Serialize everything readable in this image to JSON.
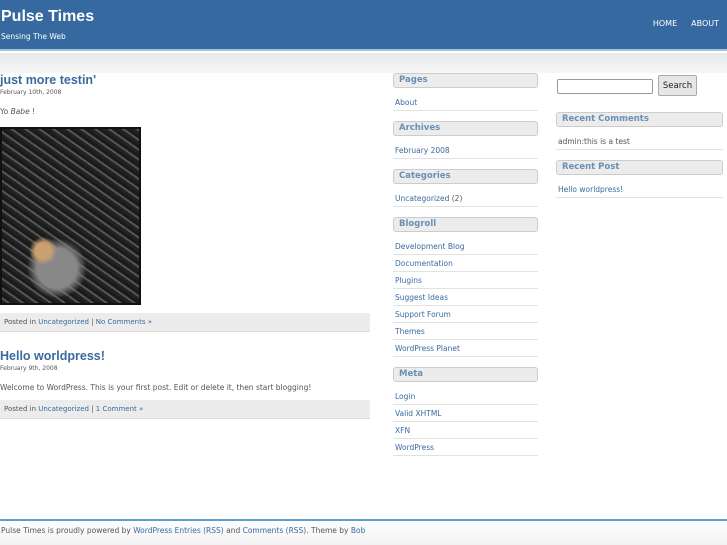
{
  "header": {
    "title": "Pulse Times",
    "tagline": "Sensing The Web",
    "nav": [
      "HOME",
      "ABOUT"
    ]
  },
  "posts": [
    {
      "title": "just more testin'",
      "date": "February 10th, 2008",
      "body_prefix": "Yo ",
      "body_em": "Babe",
      "body_suffix": " !",
      "has_image": true,
      "posted_in": "Posted in ",
      "category": "Uncategorized",
      "sep": " | ",
      "comments": "No Comments »"
    },
    {
      "title": "Hello worldpress!",
      "date": "February 9th, 2008",
      "body": "Welcome to WordPress. This is your first post. Edit or delete it, then start blogging!",
      "posted_in": "Posted in ",
      "category": "Uncategorized",
      "sep": " | ",
      "comments": "1 Comment »"
    }
  ],
  "sidebar1": {
    "pages": {
      "title": "Pages",
      "items": [
        "About"
      ]
    },
    "archives": {
      "title": "Archives",
      "items": [
        "February 2008"
      ]
    },
    "categories": {
      "title": "Categories",
      "item": "Uncategorized",
      "count": " (2)"
    },
    "blogroll": {
      "title": "Blogroll",
      "items": [
        "Development Blog",
        "Documentation",
        "Plugins",
        "Suggest Ideas",
        "Support Forum",
        "Themes",
        "WordPress Planet"
      ]
    },
    "meta": {
      "title": "Meta",
      "items": [
        "Login",
        "Valid XHTML",
        "XFN",
        "WordPress"
      ]
    }
  },
  "sidebar2": {
    "search": {
      "value": "",
      "button": "Search"
    },
    "recent_comments": {
      "title": "Recent Comments",
      "author": "admin",
      "text": ":this is a test"
    },
    "recent_post": {
      "title": "Recent Post",
      "items": [
        "Hello worldpress!"
      ]
    }
  },
  "footer": {
    "t1": "Pulse Times is proudly powered by ",
    "l1": "WordPress",
    "l2": "Entries (RSS)",
    "t2": " and ",
    "l3": "Comments (RSS)",
    "t3": ". Theme by ",
    "l4": "Bob"
  }
}
